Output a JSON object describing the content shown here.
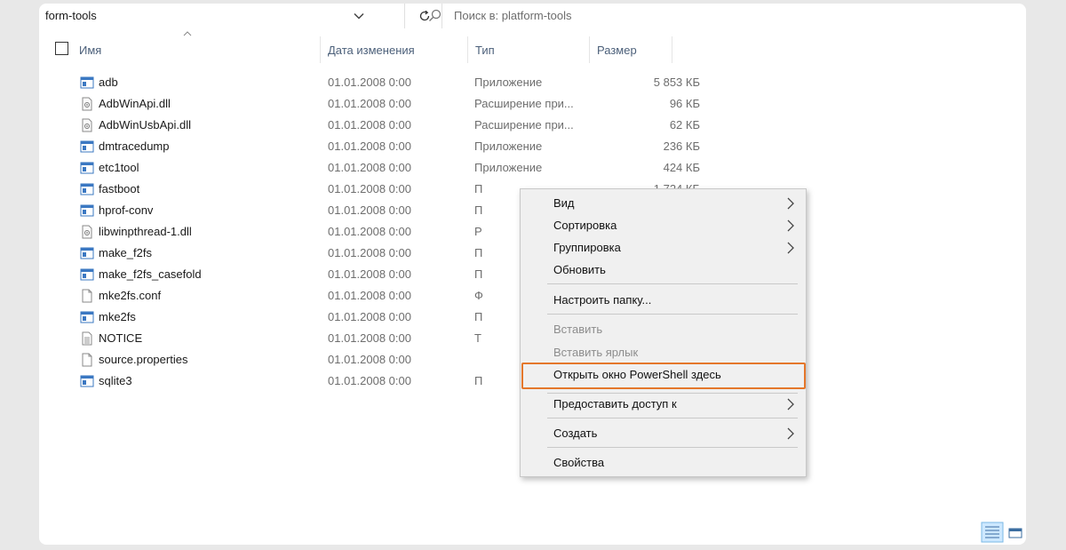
{
  "address": {
    "path": "form-tools"
  },
  "search": {
    "placeholder": "Поиск в: platform-tools"
  },
  "columns": {
    "name": "Имя",
    "date": "Дата изменения",
    "type": "Тип",
    "size": "Размер"
  },
  "files": [
    {
      "name": "adb",
      "date": "01.01.2008 0:00",
      "type": "Приложение",
      "size": "5 853 КБ",
      "icon": "app-icon"
    },
    {
      "name": "AdbWinApi.dll",
      "date": "01.01.2008 0:00",
      "type": "Расширение при...",
      "size": "96 КБ",
      "icon": "dll-icon"
    },
    {
      "name": "AdbWinUsbApi.dll",
      "date": "01.01.2008 0:00",
      "type": "Расширение при...",
      "size": "62 КБ",
      "icon": "dll-icon"
    },
    {
      "name": "dmtracedump",
      "date": "01.01.2008 0:00",
      "type": "Приложение",
      "size": "236 КБ",
      "icon": "app-icon"
    },
    {
      "name": "etc1tool",
      "date": "01.01.2008 0:00",
      "type": "Приложение",
      "size": "424 КБ",
      "icon": "app-icon"
    },
    {
      "name": "fastboot",
      "date": "01.01.2008 0:00",
      "type": "П",
      "size": "1 724 КБ",
      "icon": "app-icon"
    },
    {
      "name": "hprof-conv",
      "date": "01.01.2008 0:00",
      "type": "П",
      "size": "",
      "icon": "app-icon"
    },
    {
      "name": "libwinpthread-1.dll",
      "date": "01.01.2008 0:00",
      "type": "Р",
      "size": "",
      "icon": "dll-icon"
    },
    {
      "name": "make_f2fs",
      "date": "01.01.2008 0:00",
      "type": "П",
      "size": "",
      "icon": "app-icon"
    },
    {
      "name": "make_f2fs_casefold",
      "date": "01.01.2008 0:00",
      "type": "П",
      "size": "",
      "icon": "app-icon"
    },
    {
      "name": "mke2fs.conf",
      "date": "01.01.2008 0:00",
      "type": "Ф",
      "size": "",
      "icon": "file-icon"
    },
    {
      "name": "mke2fs",
      "date": "01.01.2008 0:00",
      "type": "П",
      "size": "",
      "icon": "app-icon"
    },
    {
      "name": "NOTICE",
      "date": "01.01.2008 0:00",
      "type": "Т",
      "size": "",
      "icon": "text-file-icon"
    },
    {
      "name": "source.properties",
      "date": "01.01.2008 0:00",
      "type": "",
      "size": "",
      "icon": "file-icon"
    },
    {
      "name": "sqlite3",
      "date": "01.01.2008 0:00",
      "type": "П",
      "size": "",
      "icon": "app-icon"
    }
  ],
  "context_menu": {
    "view": "Вид",
    "sort": "Сортировка",
    "group": "Группировка",
    "refresh": "Обновить",
    "customize": "Настроить папку...",
    "paste": "Вставить",
    "paste_shortcut": "Вставить ярлык",
    "powershell": "Открыть окно PowerShell здесь",
    "share": "Предоставить доступ к",
    "create": "Создать",
    "properties": "Свойства"
  },
  "colors": {
    "highlight_border": "#e4772b",
    "menu_bg": "#f0f0f0",
    "header_text": "#4c607a"
  }
}
